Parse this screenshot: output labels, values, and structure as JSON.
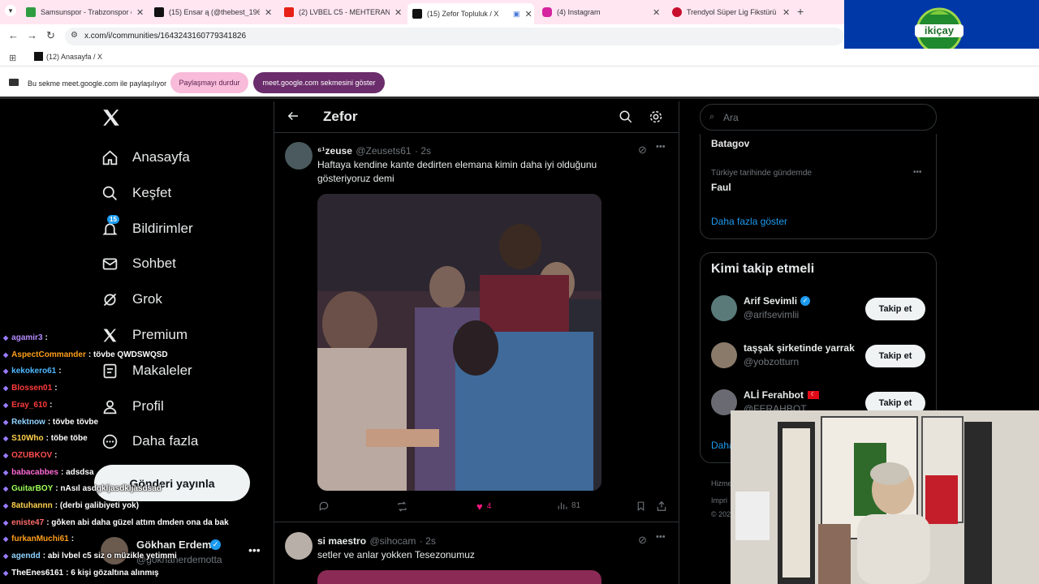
{
  "browser": {
    "tabs": [
      {
        "title": "Samsunspor - Trabzonspor canlı",
        "color": "#2e9d42"
      },
      {
        "title": "(15) Ensar ą (@thebest_1967) / X",
        "color": "#111111"
      },
      {
        "title": "(2) LVBEL C5 - MEHTERAN REM",
        "color": "#e62117"
      },
      {
        "title": "(15) Zefor Topluluk / X",
        "color": "#111111"
      },
      {
        "title": "(4) Instagram",
        "color": "#d6249f"
      },
      {
        "title": "Trendyol Süper Lig Fikstürü ve P",
        "color": "#c8102e"
      }
    ],
    "url": "x.com/i/communities/1643243160779341826",
    "bookmark": "(12) Anasayfa / X",
    "share_text": "Bu sekme meet.google.com ile paylaşılıyor",
    "stop_share": "Paylaşmayı durdur",
    "show_tab": "meet.google.com sekmesini göster",
    "logo_text": "ikiçay"
  },
  "left_nav": {
    "items": [
      "Anasayfa",
      "Keşfet",
      "Bildirimler",
      "Sohbet",
      "Grok",
      "Premium",
      "Makaleler",
      "Profil",
      "Daha fazla"
    ],
    "notif_count": "15",
    "post_button": "Gönderi yayınla",
    "account_name": "Gökhan Erdem",
    "account_handle": "@gokhanerdemotta"
  },
  "feed": {
    "title": "Zefor",
    "tweet1": {
      "name": "⁶¹zeuse",
      "handle": "@Zeusets61",
      "time": "· 2s",
      "text": "Haftaya kendine kante dedirten elemana kimin daha iyi olduğunu gösteriyoruz demi",
      "likes": "4",
      "views": "81"
    },
    "tweet2": {
      "name": "si maestro",
      "handle": "@sihocam",
      "time": "· 2s",
      "text": "setler ve anlar yokken Tesezonumuz"
    }
  },
  "sidebar": {
    "search_placeholder": "Ara",
    "trend_top": "Batagov",
    "trend_context": "Türkiye tarihinde gündemde",
    "trend_name": "Faul",
    "show_more": "Daha fazla göster",
    "who_to_follow": "Kimi takip etmeli",
    "follow_label": "Takip et",
    "suggestions": [
      {
        "name": "Arif Sevimli",
        "handle": "@arifsevimlii"
      },
      {
        "name": "taşşak şirketinde yarrak",
        "handle": "@yobzotturn"
      },
      {
        "name": "ALİ Ferahbot",
        "handle": "@FERAHBOT"
      }
    ],
    "show_more_partial": "Daha",
    "footer1": "Hizme",
    "footer2": "Impri",
    "footer3": "© 202"
  },
  "chat": [
    {
      "user": "agamir3",
      "msg": ":",
      "color": "#b48cff"
    },
    {
      "user": "AspectCommander",
      "msg": ": tövbe QWDSWQSD",
      "color": "#ff9f1a"
    },
    {
      "user": "kekokero61",
      "msg": ":",
      "color": "#4db8ff"
    },
    {
      "user": "Blossen01",
      "msg": ":",
      "color": "#ff3b3b"
    },
    {
      "user": "Eray_610",
      "msg": ":",
      "color": "#ff3b3b"
    },
    {
      "user": "Rektnow",
      "msg": ": tövbe tövbe",
      "color": "#8fd3ff"
    },
    {
      "user": "S10Who",
      "msg": ": töbe töbe",
      "color": "#ffd24d"
    },
    {
      "user": "OZUBKOV",
      "msg": ":",
      "color": "#ff4f4f"
    },
    {
      "user": "babacabbes",
      "msg": ": adsdsa",
      "color": "#ff6bd6"
    },
    {
      "user": "GuitarBOY",
      "msg": ": nAsıl asdgkljasdkljasdsad",
      "color": "#9dff5a"
    },
    {
      "user": "8atuhannn",
      "msg": ": (derbi galibiyeti yok)",
      "color": "#ffd24d"
    },
    {
      "user": "eniste47",
      "msg": ": gôken abi daha güzel attım dmden ona da bak",
      "color": "#ff6b6b"
    },
    {
      "user": "furkanMuchi61",
      "msg": ":",
      "color": "#ff9f1a"
    },
    {
      "user": "agendd",
      "msg": ": abi lvbel c5 siz o müzikle yetimmi",
      "color": "#8fd3ff"
    },
    {
      "user": "TheEnes6161",
      "msg": ": 6 kişi gözaltına alınmış",
      "color": "#ffffff"
    }
  ],
  "colors": {
    "accent": "#1d9bf0",
    "like": "#f91880",
    "pill_pink": "#f8bbd9",
    "pill_purple": "#6b2d6b"
  }
}
